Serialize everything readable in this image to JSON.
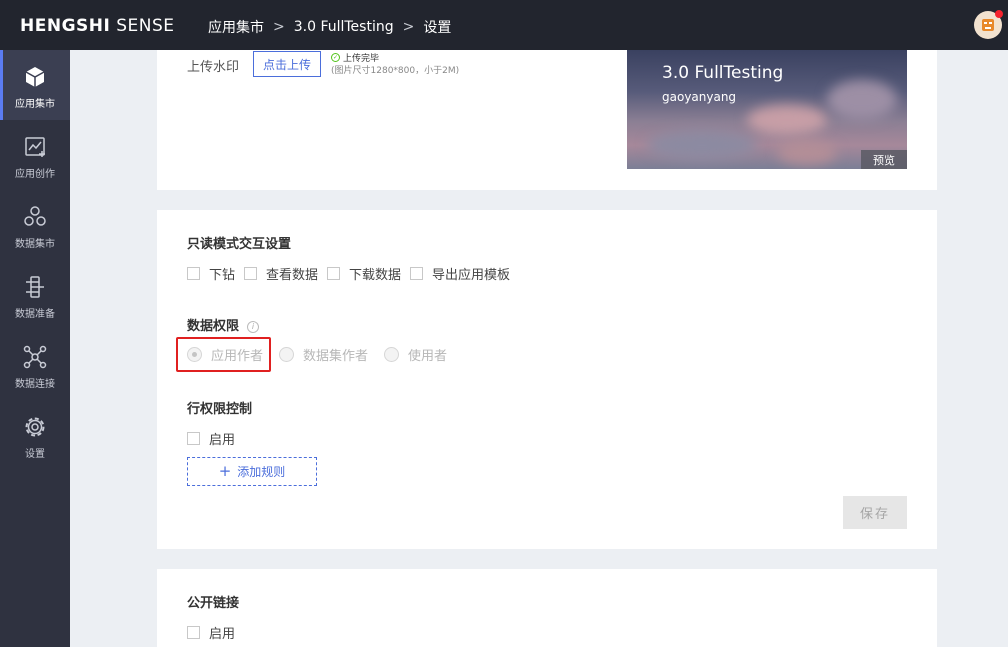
{
  "header": {
    "brand_bold": "HENGSHI",
    "brand_light": "SENSE",
    "breadcrumbs": [
      "应用集市",
      "3.0 FullTesting",
      "设置"
    ],
    "separator": ">"
  },
  "sidebar": {
    "items": [
      {
        "label": "应用集市",
        "icon": "cube-icon"
      },
      {
        "label": "应用创作",
        "icon": "chart-edit-icon"
      },
      {
        "label": "数据集市",
        "icon": "dataset-icon"
      },
      {
        "label": "数据准备",
        "icon": "data-prep-icon"
      },
      {
        "label": "数据连接",
        "icon": "connection-icon"
      },
      {
        "label": "设置",
        "icon": "gear-icon"
      }
    ]
  },
  "watermark": {
    "label": "上传水印",
    "button": "点击上传",
    "status": "上传完毕",
    "hint": "(图片尺寸1280*800，小于2M)"
  },
  "preview": {
    "title": "3.0 FullTesting",
    "user": "gaoyanyang",
    "button": "预览"
  },
  "readonly": {
    "title": "只读模式交互设置",
    "options": [
      "下钻",
      "查看数据",
      "下载数据",
      "导出应用模板"
    ]
  },
  "permission": {
    "title": "数据权限",
    "options": [
      "应用作者",
      "数据集作者",
      "使用者"
    ],
    "selected": "应用作者"
  },
  "row_permission": {
    "title": "行权限控制",
    "enable_label": "启用",
    "add_rule": "添加规则",
    "save": "保存"
  },
  "public_link": {
    "title": "公开链接",
    "enable_label": "启用"
  },
  "colors": {
    "accent": "#4b6edb",
    "topbar": "#22252e",
    "sidebar": "#2f3240",
    "highlight": "#e02020"
  }
}
